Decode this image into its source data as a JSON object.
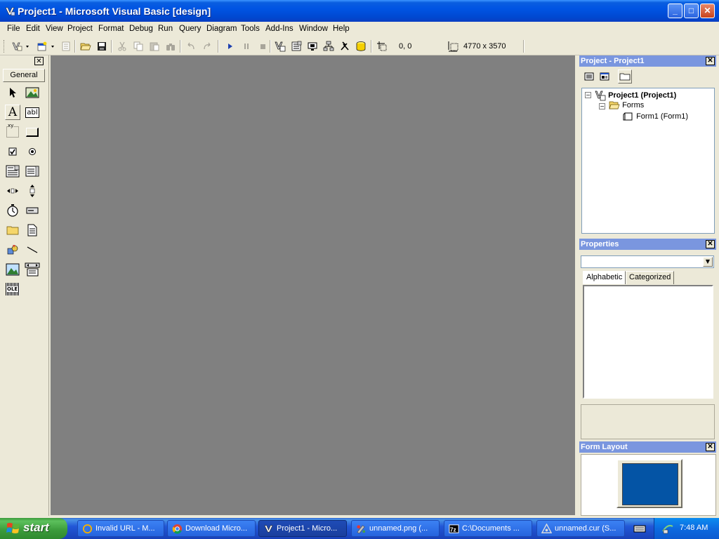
{
  "window": {
    "title": "Project1 - Microsoft Visual Basic [design]",
    "minimize": "_",
    "maximize": "□",
    "close": "✕"
  },
  "menu": [
    "File",
    "Edit",
    "View",
    "Project",
    "Format",
    "Debug",
    "Run",
    "Query",
    "Diagram",
    "Tools",
    "Add-Ins",
    "Window",
    "Help"
  ],
  "toolbar": {
    "position": "0, 0",
    "size": "4770 x 3570"
  },
  "toolbox": {
    "close": "✕",
    "tab": "General",
    "tools": [
      "pointer-icon",
      "picturebox-icon",
      "label-icon",
      "textbox-icon",
      "frame-icon",
      "commandbutton-icon",
      "checkbox-icon",
      "optionbutton-icon",
      "combobox-icon",
      "listbox-icon",
      "hscrollbar-icon",
      "vscrollbar-icon",
      "timer-icon",
      "drivelistbox-icon",
      "dirlistbox-icon",
      "filelistbox-icon",
      "shape-icon",
      "line-icon",
      "image-icon",
      "data-icon",
      "ole-icon"
    ],
    "label_glyph": "A",
    "textbox_glyph": "abl",
    "frame_glyph": "xy",
    "ole_glyph": "OLE"
  },
  "project": {
    "title": "Project - Project1",
    "close": "✕",
    "root": "Project1 (Project1)",
    "folder": "Forms",
    "form": "Form1 (Form1)"
  },
  "properties": {
    "title": "Properties",
    "close": "✕",
    "tabs": [
      "Alphabetic",
      "Categorized"
    ]
  },
  "form_layout": {
    "title": "Form Layout",
    "close": "✕"
  },
  "taskbar": {
    "start": "start",
    "items": [
      {
        "label": "Invalid URL - M...",
        "icon": "ie-icon"
      },
      {
        "label": "Download Micro...",
        "icon": "chrome-icon"
      },
      {
        "label": "Project1 - Micro...",
        "icon": "vb-icon"
      },
      {
        "label": "unnamed.png (...",
        "icon": "paint-icon"
      },
      {
        "label": "C:\\Documents ...",
        "icon": "7zip-icon"
      },
      {
        "label": "unnamed.cur (S...",
        "icon": "cursor-editor-icon"
      }
    ],
    "clock": "7:48 AM"
  },
  "colors": {
    "workspace": "#808080",
    "pane_title": "#7a96df",
    "monitor_screen": "#0454a5"
  }
}
